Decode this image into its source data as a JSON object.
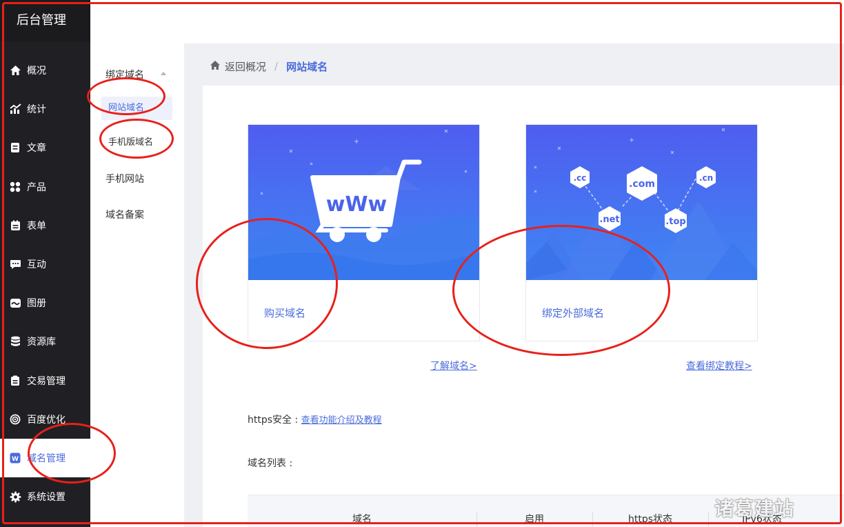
{
  "brand": "后台管理",
  "nav": [
    {
      "label": "概况",
      "icon": "home-icon"
    },
    {
      "label": "统计",
      "icon": "chart-icon"
    },
    {
      "label": "文章",
      "icon": "article-icon"
    },
    {
      "label": "产品",
      "icon": "grid-icon"
    },
    {
      "label": "表单",
      "icon": "form-icon"
    },
    {
      "label": "互动",
      "icon": "chat-icon"
    },
    {
      "label": "图册",
      "icon": "album-icon"
    },
    {
      "label": "资源库",
      "icon": "database-icon"
    },
    {
      "label": "交易管理",
      "icon": "trade-icon"
    },
    {
      "label": "百度优化",
      "icon": "seo-icon"
    },
    {
      "label": "域名管理",
      "icon": "domain-icon",
      "active": true
    },
    {
      "label": "系统设置",
      "icon": "gear-icon"
    }
  ],
  "submenu": {
    "group_label": "绑定域名",
    "items": [
      "网站域名",
      "手机版域名"
    ],
    "extra": [
      "手机网站",
      "域名备案"
    ]
  },
  "breadcrumb": {
    "back": "返回概况",
    "current": "网站域名"
  },
  "cards": [
    {
      "label": "购买域名",
      "link": "了解域名>"
    },
    {
      "label": "绑定外部域名",
      "link": "查看绑定教程>"
    }
  ],
  "art": {
    "www": "wWw",
    "tlds": [
      ".cc",
      ".com",
      ".cn",
      ".net",
      ".top"
    ]
  },
  "https": {
    "label": "https安全 :",
    "link": "查看功能介绍及教程"
  },
  "domain_list_label": "域名列表 :",
  "table": {
    "columns": [
      "域名",
      "启用",
      "https状态",
      "IPv6状态"
    ]
  },
  "watermark": "诸葛建站",
  "colors": {
    "accent": "#4a6bdc",
    "sidebar": "#202024",
    "annotation": "#e8201a"
  }
}
